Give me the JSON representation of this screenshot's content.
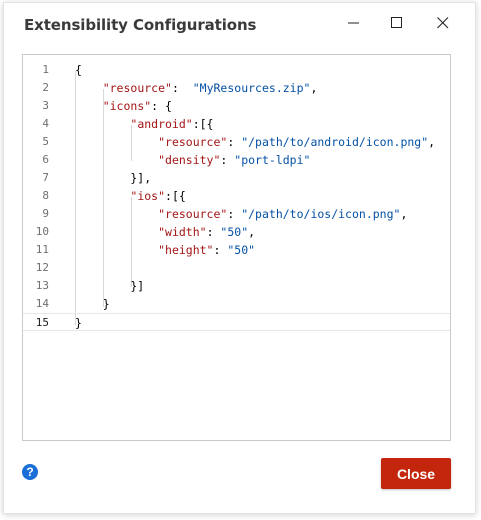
{
  "window": {
    "title": "Extensibility Configurations",
    "controls": [
      "minimize-icon",
      "maximize-icon",
      "close-icon"
    ]
  },
  "editor": {
    "active_line": 15,
    "lines": [
      {
        "n": "1",
        "tokens": [
          {
            "t": "{",
            "c": "p"
          }
        ]
      },
      {
        "n": "2",
        "tokens": [
          {
            "t": "    ",
            "c": "p"
          },
          {
            "t": "\"resource\"",
            "c": "k"
          },
          {
            "t": ":  ",
            "c": "p"
          },
          {
            "t": "\"MyResources.zip\"",
            "c": "s"
          },
          {
            "t": ",",
            "c": "p"
          }
        ]
      },
      {
        "n": "3",
        "tokens": [
          {
            "t": "    ",
            "c": "p"
          },
          {
            "t": "\"icons\"",
            "c": "k"
          },
          {
            "t": ": {",
            "c": "p"
          }
        ]
      },
      {
        "n": "4",
        "tokens": [
          {
            "t": "        ",
            "c": "p"
          },
          {
            "t": "\"android\"",
            "c": "k"
          },
          {
            "t": ":[{",
            "c": "p"
          }
        ]
      },
      {
        "n": "5",
        "tokens": [
          {
            "t": "            ",
            "c": "p"
          },
          {
            "t": "\"resource\"",
            "c": "k"
          },
          {
            "t": ": ",
            "c": "p"
          },
          {
            "t": "\"/path/to/android/icon.png\"",
            "c": "s"
          },
          {
            "t": ",",
            "c": "p"
          }
        ]
      },
      {
        "n": "6",
        "tokens": [
          {
            "t": "            ",
            "c": "p"
          },
          {
            "t": "\"density\"",
            "c": "k"
          },
          {
            "t": ": ",
            "c": "p"
          },
          {
            "t": "\"port-ldpi\"",
            "c": "s"
          }
        ]
      },
      {
        "n": "7",
        "tokens": [
          {
            "t": "        }],",
            "c": "p"
          }
        ]
      },
      {
        "n": "8",
        "tokens": [
          {
            "t": "        ",
            "c": "p"
          },
          {
            "t": "\"ios\"",
            "c": "k"
          },
          {
            "t": ":[{",
            "c": "p"
          }
        ]
      },
      {
        "n": "9",
        "tokens": [
          {
            "t": "            ",
            "c": "p"
          },
          {
            "t": "\"resource\"",
            "c": "k"
          },
          {
            "t": ": ",
            "c": "p"
          },
          {
            "t": "\"/path/to/ios/icon.png\"",
            "c": "s"
          },
          {
            "t": ",",
            "c": "p"
          }
        ]
      },
      {
        "n": "10",
        "tokens": [
          {
            "t": "            ",
            "c": "p"
          },
          {
            "t": "\"width\"",
            "c": "k"
          },
          {
            "t": ": ",
            "c": "p"
          },
          {
            "t": "\"50\"",
            "c": "s"
          },
          {
            "t": ",",
            "c": "p"
          }
        ]
      },
      {
        "n": "11",
        "tokens": [
          {
            "t": "            ",
            "c": "p"
          },
          {
            "t": "\"height\"",
            "c": "k"
          },
          {
            "t": ": ",
            "c": "p"
          },
          {
            "t": "\"50\"",
            "c": "s"
          }
        ]
      },
      {
        "n": "12",
        "tokens": []
      },
      {
        "n": "13",
        "tokens": [
          {
            "t": "        }]",
            "c": "p"
          }
        ]
      },
      {
        "n": "14",
        "tokens": [
          {
            "t": "    }",
            "c": "p"
          }
        ]
      },
      {
        "n": "15",
        "tokens": [
          {
            "t": "}",
            "c": "p"
          }
        ]
      }
    ]
  },
  "footer": {
    "help_label": "?",
    "close_label": "Close"
  },
  "colors": {
    "accent": "#c3260c",
    "help": "#1c6fd6",
    "json_key": "#a31515",
    "json_string": "#0451a5"
  }
}
